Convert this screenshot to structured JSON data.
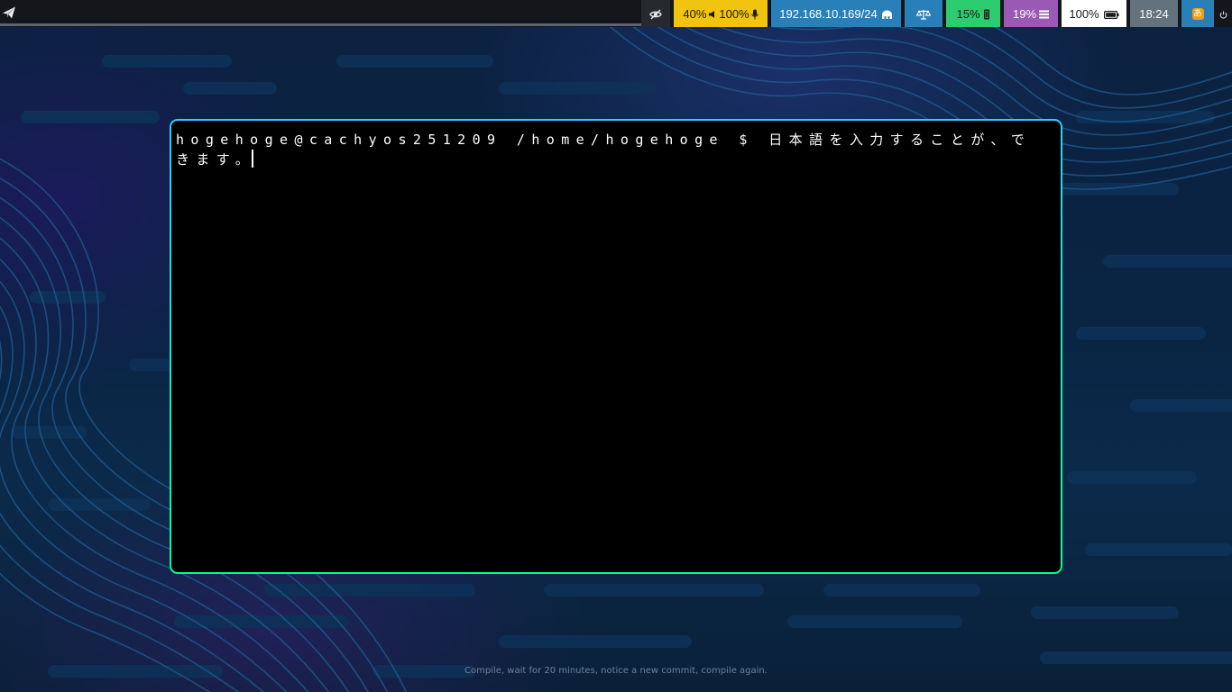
{
  "topbar": {
    "launcher_icon": "paper-plane-icon",
    "modules": {
      "idle_inhibitor": {
        "icon": "eye-slash-icon"
      },
      "audio": {
        "volume": "40%",
        "volume_icon": "speaker-icon",
        "mic": "100%",
        "mic_icon": "microphone-icon"
      },
      "network": {
        "address": "192.168.10.169/24",
        "icon": "wired-network-icon"
      },
      "power_profile": {
        "icon": "balance-scale-icon"
      },
      "cpu": {
        "value": "15%",
        "icon": "cpu-chip-icon"
      },
      "memory": {
        "value": "19%",
        "icon": "memory-bars-icon"
      },
      "battery": {
        "value": "100%",
        "icon": "battery-full-icon"
      },
      "clock": {
        "time": "18:24"
      },
      "ime": {
        "glyph": "あ"
      },
      "power_menu": {
        "icon": "power-icon"
      }
    },
    "colors": {
      "audio": "#f1c40f",
      "network": "#2980b9",
      "cpu": "#2ecc71",
      "memory": "#9b59b6",
      "battery": "#ffffff",
      "clock": "#64727d"
    }
  },
  "terminal": {
    "prompt": "hogehoge@cachyos251209 /home/hogehoge $ ",
    "input": "日本語を入力することが、できます。",
    "border_colors": [
      "#33ccff",
      "#00ff99"
    ]
  },
  "wallpaper": {
    "quote": "Compile, wait for 20 minutes, notice a new commit, compile again."
  }
}
